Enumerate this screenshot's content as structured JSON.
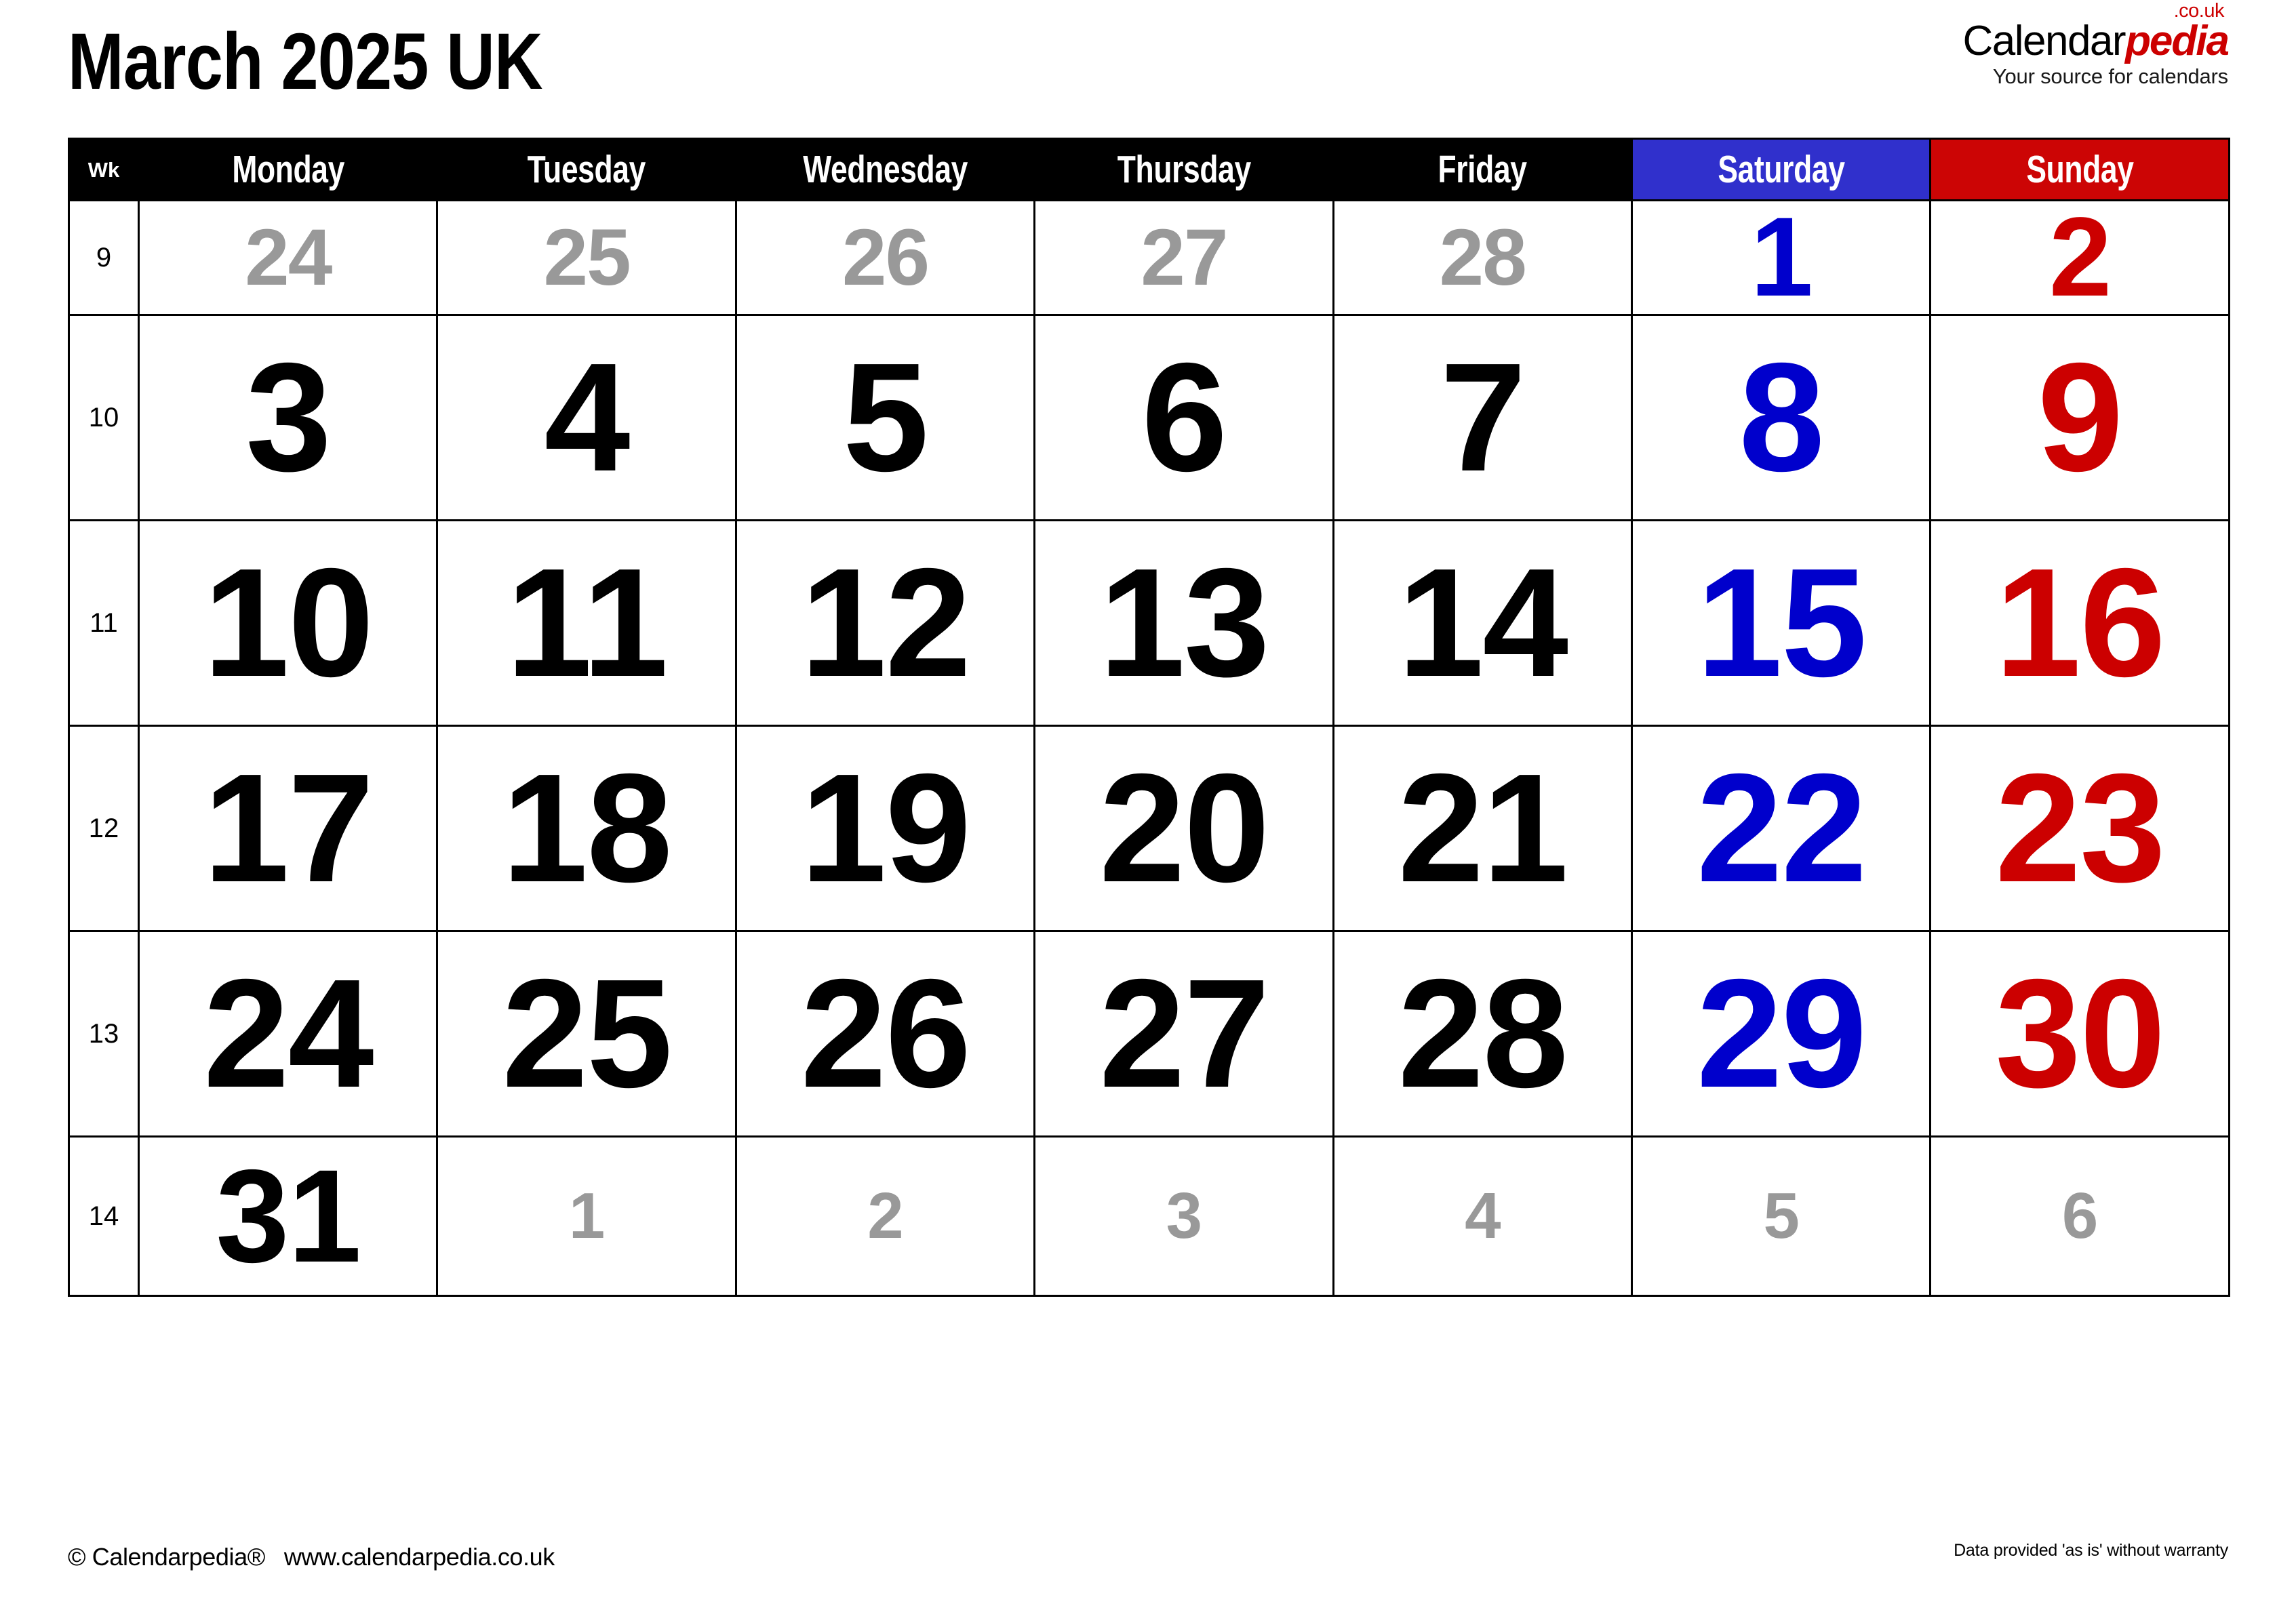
{
  "page": {
    "title": "March 2025 UK",
    "month": "March",
    "year": "2025",
    "region": "UK"
  },
  "brand": {
    "name_black": "Calendar",
    "name_red": "pedia",
    "tld": ".co.uk",
    "tagline": "Your source for calendars"
  },
  "colors": {
    "header_bg": "#000000",
    "saturday_bg": "#3030cc",
    "sunday_bg": "#cc0505",
    "saturday_text": "#0000cc",
    "sunday_text": "#cc0000",
    "out_of_month_text": "#999999",
    "grid_line": "#000000",
    "brand_red": "#cc0000"
  },
  "table": {
    "week_header": "Wk",
    "day_headers": [
      "Monday",
      "Tuesday",
      "Wednesday",
      "Thursday",
      "Friday",
      "Saturday",
      "Sunday"
    ],
    "weeks": [
      {
        "wk": "9",
        "days": [
          {
            "n": "24",
            "m": "prev"
          },
          {
            "n": "25",
            "m": "prev"
          },
          {
            "n": "26",
            "m": "prev"
          },
          {
            "n": "27",
            "m": "prev"
          },
          {
            "n": "28",
            "m": "prev"
          },
          {
            "n": "1",
            "m": "cur",
            "t": "sat"
          },
          {
            "n": "2",
            "m": "cur",
            "t": "sun"
          }
        ]
      },
      {
        "wk": "10",
        "days": [
          {
            "n": "3",
            "m": "cur"
          },
          {
            "n": "4",
            "m": "cur"
          },
          {
            "n": "5",
            "m": "cur"
          },
          {
            "n": "6",
            "m": "cur"
          },
          {
            "n": "7",
            "m": "cur"
          },
          {
            "n": "8",
            "m": "cur",
            "t": "sat"
          },
          {
            "n": "9",
            "m": "cur",
            "t": "sun"
          }
        ]
      },
      {
        "wk": "11",
        "days": [
          {
            "n": "10",
            "m": "cur"
          },
          {
            "n": "11",
            "m": "cur"
          },
          {
            "n": "12",
            "m": "cur"
          },
          {
            "n": "13",
            "m": "cur"
          },
          {
            "n": "14",
            "m": "cur"
          },
          {
            "n": "15",
            "m": "cur",
            "t": "sat"
          },
          {
            "n": "16",
            "m": "cur",
            "t": "sun"
          }
        ]
      },
      {
        "wk": "12",
        "days": [
          {
            "n": "17",
            "m": "cur"
          },
          {
            "n": "18",
            "m": "cur"
          },
          {
            "n": "19",
            "m": "cur"
          },
          {
            "n": "20",
            "m": "cur"
          },
          {
            "n": "21",
            "m": "cur"
          },
          {
            "n": "22",
            "m": "cur",
            "t": "sat"
          },
          {
            "n": "23",
            "m": "cur",
            "t": "sun"
          }
        ]
      },
      {
        "wk": "13",
        "days": [
          {
            "n": "24",
            "m": "cur"
          },
          {
            "n": "25",
            "m": "cur"
          },
          {
            "n": "26",
            "m": "cur"
          },
          {
            "n": "27",
            "m": "cur"
          },
          {
            "n": "28",
            "m": "cur"
          },
          {
            "n": "29",
            "m": "cur",
            "t": "sat"
          },
          {
            "n": "30",
            "m": "cur",
            "t": "sun"
          }
        ]
      },
      {
        "wk": "14",
        "days": [
          {
            "n": "31",
            "m": "cur"
          },
          {
            "n": "1",
            "m": "next"
          },
          {
            "n": "2",
            "m": "next"
          },
          {
            "n": "3",
            "m": "next"
          },
          {
            "n": "4",
            "m": "next"
          },
          {
            "n": "5",
            "m": "next"
          },
          {
            "n": "6",
            "m": "next"
          }
        ]
      }
    ]
  },
  "footer": {
    "copyright": "© Calendarpedia®",
    "website": "www.calendarpedia.co.uk",
    "disclaimer": "Data provided 'as is' without warranty"
  }
}
